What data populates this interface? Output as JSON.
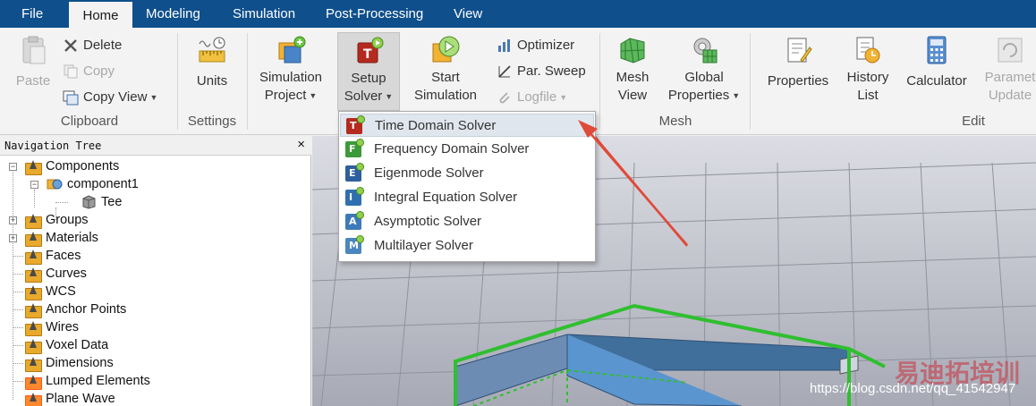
{
  "menu": [
    "File",
    "Home",
    "Modeling",
    "Simulation",
    "Post-Processing",
    "View"
  ],
  "ribbon": {
    "clipboard": {
      "paste": "Paste",
      "delete": "Delete",
      "copy": "Copy",
      "copy_view": "Copy View",
      "label": "Clipboard"
    },
    "settings": {
      "units": "Units",
      "label": "Settings"
    },
    "simulation": {
      "project_line1": "Simulation",
      "project_line2": "Project",
      "setup_line1": "Setup",
      "setup_line2": "Solver",
      "start_line1": "Start",
      "start_line2": "Simulation",
      "optimizer": "Optimizer",
      "par_sweep": "Par. Sweep",
      "logfile": "Logfile"
    },
    "mesh": {
      "mesh_view_line1": "Mesh",
      "mesh_view_line2": "View",
      "global_line1": "Global",
      "global_line2": "Properties",
      "label": "Mesh"
    },
    "edit": {
      "properties": "Properties",
      "history_line1": "History",
      "history_line2": "List",
      "calculator": "Calculator",
      "param_line1": "Paramet",
      "param_line2": "Update",
      "label": "Edit"
    }
  },
  "solver_menu": [
    {
      "label": "Time Domain Solver",
      "letter": "T",
      "color": "#b52a1f"
    },
    {
      "label": "Frequency Domain Solver",
      "letter": "F",
      "color": "#3c9a3a"
    },
    {
      "label": "Eigenmode Solver",
      "letter": "E",
      "color": "#2f5f9c"
    },
    {
      "label": "Integral Equation Solver",
      "letter": "I",
      "color": "#2f6fb0"
    },
    {
      "label": "Asymptotic Solver",
      "letter": "A",
      "color": "#3d7ab8"
    },
    {
      "label": "Multilayer Solver",
      "letter": "M",
      "color": "#4a86c0"
    }
  ],
  "nav": {
    "title": "Navigation Tree",
    "close": "×",
    "items": [
      "Components",
      "component1",
      "Tee",
      "Groups",
      "Materials",
      "Faces",
      "Curves",
      "WCS",
      "Anchor Points",
      "Wires",
      "Voxel Data",
      "Dimensions",
      "Lumped Elements",
      "Plane Wave"
    ]
  },
  "watermark": "https://blog.csdn.net/qq_41542947",
  "watermark_cn": "易迪拓培训",
  "colors": {
    "menubar": "#0f4f8c",
    "ribbon": "#f3f3f3",
    "accent_arrow": "#e04a3a",
    "model_edge": "#2fbf2f",
    "model_face": "#3f6f9a"
  }
}
